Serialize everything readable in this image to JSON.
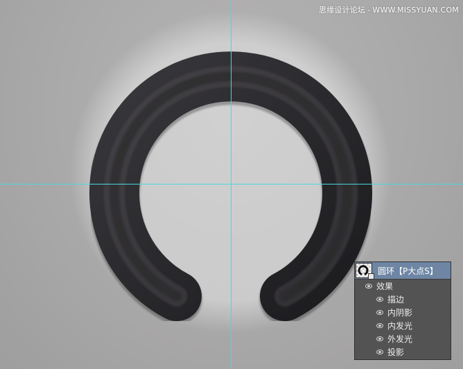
{
  "watermark": {
    "site_name": "思缘设计论坛",
    "site_url": "WWW.MISSYUAN.COM"
  },
  "layers_panel": {
    "layer_name": "圆环【P大点S】",
    "effects_group_label": "效果",
    "effects": [
      {
        "label": "描边"
      },
      {
        "label": "内阴影"
      },
      {
        "label": "内发光"
      },
      {
        "label": "外发光"
      },
      {
        "label": "投影"
      }
    ]
  },
  "colors": {
    "guide": "#4fd6e0",
    "ring": "#2a2a2d",
    "layer_selected": "#6e86a4",
    "panel_bg": "#535353"
  }
}
